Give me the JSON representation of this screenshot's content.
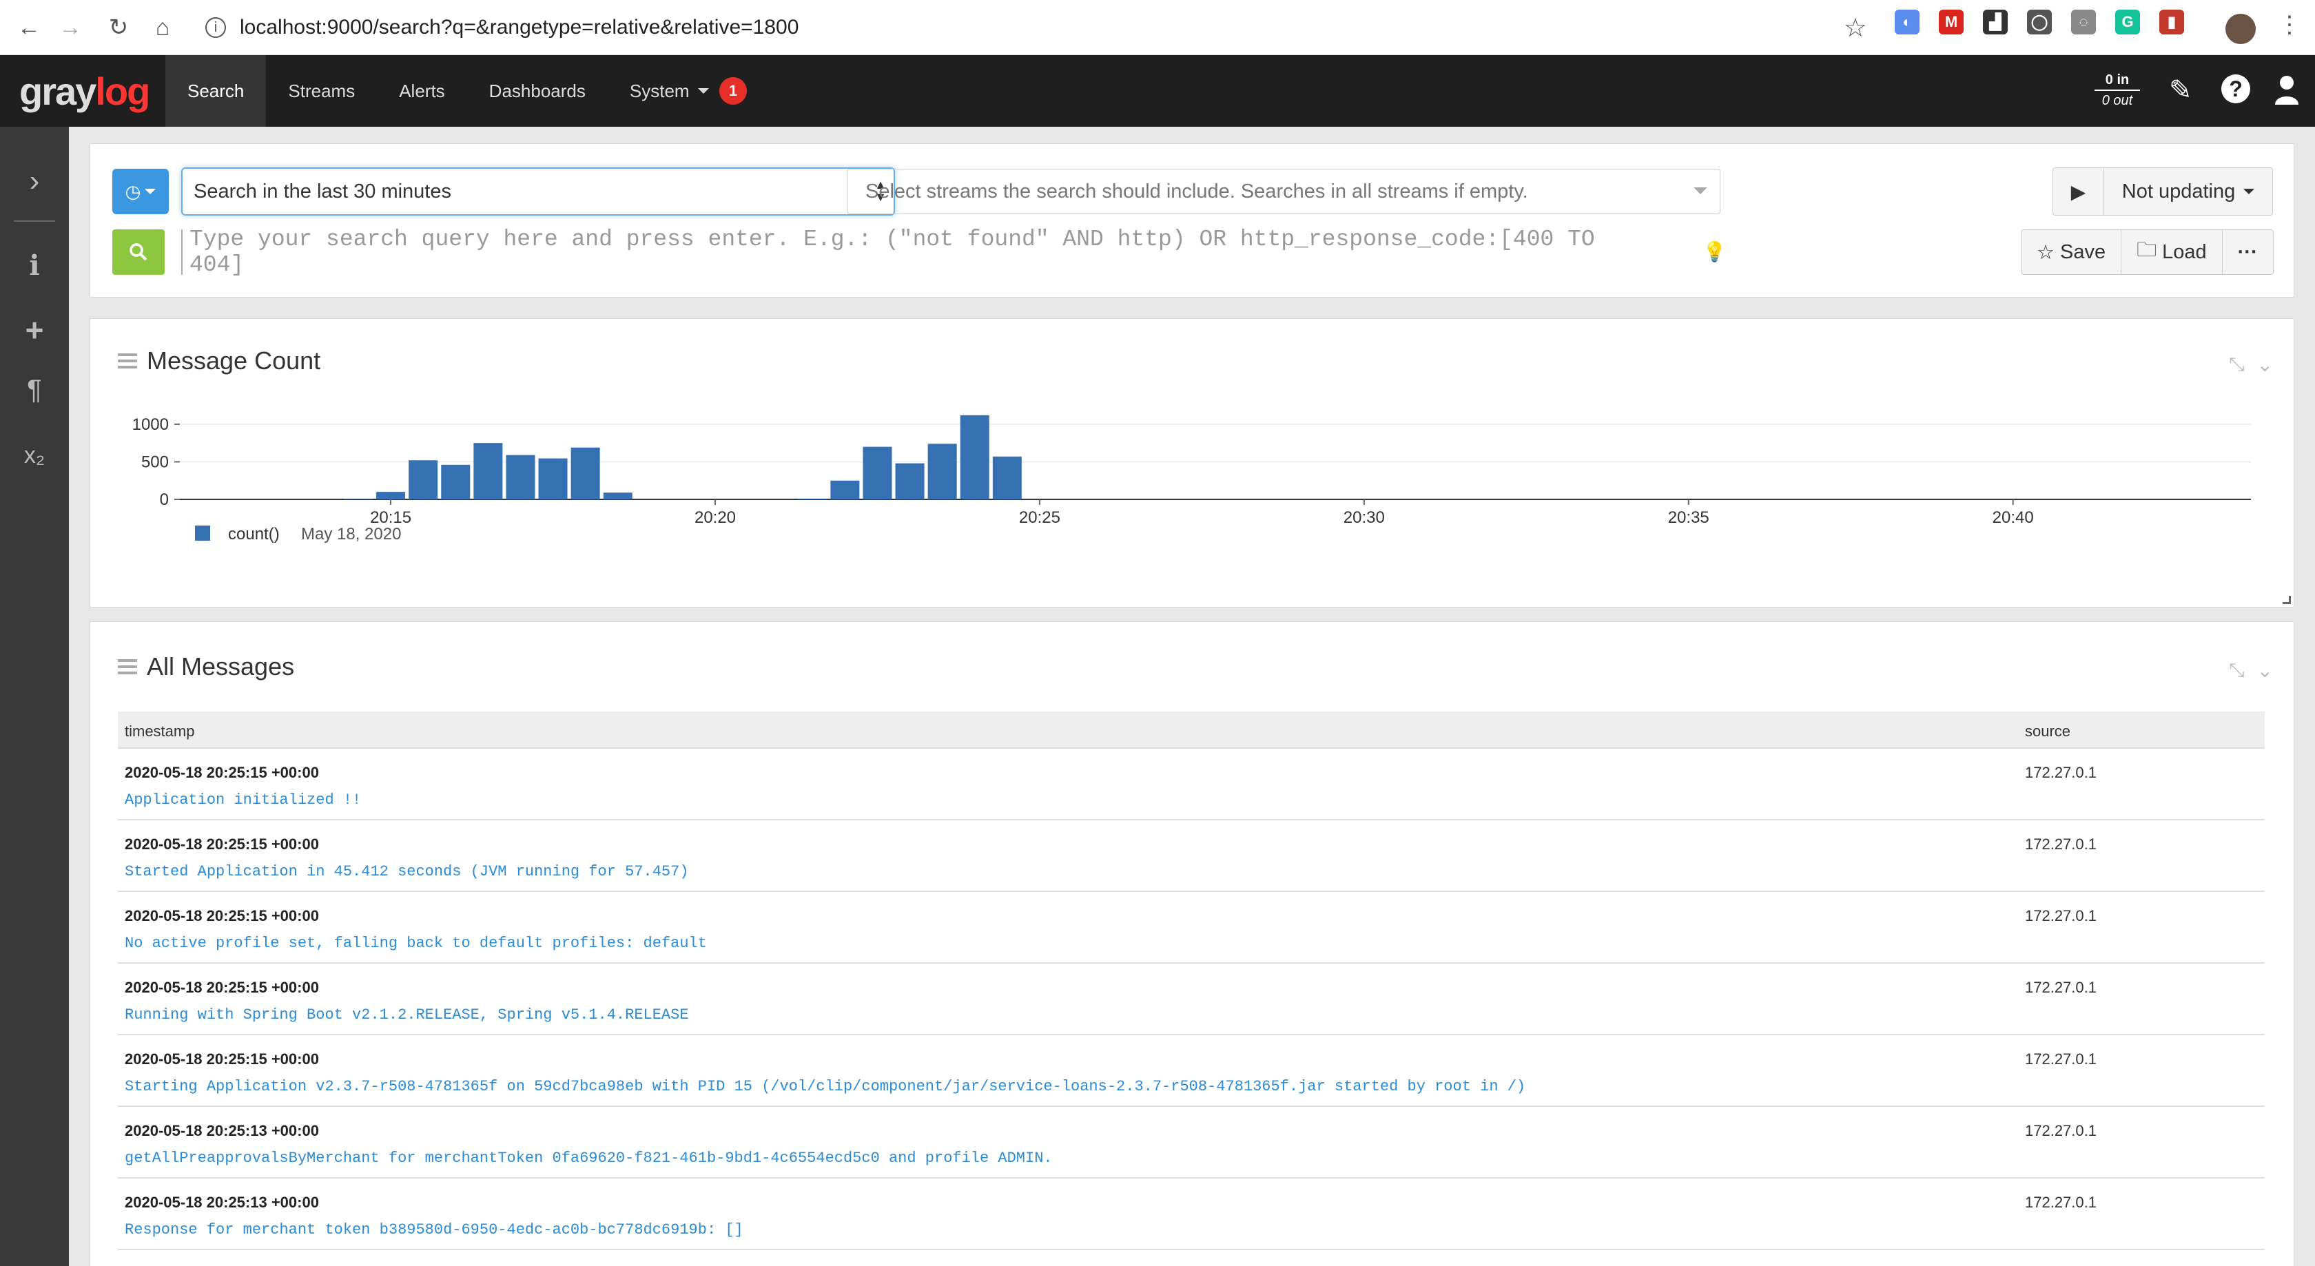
{
  "browser": {
    "url": "localhost:9000/search?q=&rangetype=relative&relative=1800",
    "extensions": [
      {
        "name": "ext-1",
        "color": "#5b8def",
        "glyph": "◐"
      },
      {
        "name": "ext-2",
        "color": "#d9261c",
        "glyph": "M"
      },
      {
        "name": "ext-3",
        "color": "#333333",
        "glyph": "▟"
      },
      {
        "name": "ext-4",
        "color": "#555555",
        "glyph": "◯"
      },
      {
        "name": "ext-5",
        "color": "#888888",
        "glyph": "◌"
      },
      {
        "name": "ext-6",
        "color": "#15c39a",
        "glyph": "G"
      },
      {
        "name": "ext-7",
        "color": "#c0392b",
        "glyph": "▮"
      }
    ]
  },
  "app": {
    "logo_gray": "gray",
    "logo_log": "log",
    "nav": {
      "search": "Search",
      "streams": "Streams",
      "alerts": "Alerts",
      "dashboards": "Dashboards",
      "system": "System"
    },
    "notification_count": "1",
    "throughput_in": "0 in",
    "throughput_out": "0 out"
  },
  "search": {
    "time_range": "Search in the last 30 minutes",
    "streams_placeholder": "Select streams the search should include. Searches in all streams if empty.",
    "update_label": "Not updating",
    "query_placeholder": "Type your search query here and press enter. E.g.: (\"not found\" AND http) OR http_response_code:[400 TO 404]",
    "save_label": "Save",
    "load_label": "Load",
    "more_label": "···"
  },
  "message_count": {
    "title": "Message Count",
    "legend_label": "count()",
    "legend_date": "May 18, 2020"
  },
  "chart_data": {
    "type": "bar",
    "title": "Message Count",
    "xlabel": "",
    "ylabel": "",
    "ylim": [
      0,
      1100
    ],
    "yticks": [
      0,
      500,
      1000
    ],
    "xticks": [
      "20:15",
      "20:20",
      "20:25",
      "20:30",
      "20:35",
      "20:40"
    ],
    "grid": true,
    "legend_placement": "bottom-left",
    "series": [
      {
        "name": "count()",
        "color": "#3570b2",
        "x": [
          "20:14:30",
          "20:15:00",
          "20:15:30",
          "20:16:00",
          "20:16:30",
          "20:17:00",
          "20:17:30",
          "20:18:00",
          "20:18:30",
          "20:21:00",
          "20:21:30",
          "20:22:00",
          "20:22:30",
          "20:23:00",
          "20:23:30",
          "20:24:00",
          "20:24:30",
          "20:25:00"
        ],
        "values": [
          5,
          100,
          520,
          460,
          750,
          590,
          545,
          690,
          90,
          0,
          10,
          250,
          700,
          480,
          740,
          1120,
          570,
          0
        ]
      }
    ]
  },
  "messages": {
    "title": "All Messages",
    "col_timestamp": "timestamp",
    "col_source": "source",
    "rows": [
      {
        "timestamp": "2020-05-18 20:25:15 +00:00",
        "message": "Application initialized !!",
        "source": "172.27.0.1"
      },
      {
        "timestamp": "2020-05-18 20:25:15 +00:00",
        "message": "Started Application in 45.412 seconds (JVM running for 57.457)",
        "source": "172.27.0.1"
      },
      {
        "timestamp": "2020-05-18 20:25:15 +00:00",
        "message": "No active profile set, falling back to default profiles: default",
        "source": "172.27.0.1"
      },
      {
        "timestamp": "2020-05-18 20:25:15 +00:00",
        "message": "Running with Spring Boot v2.1.2.RELEASE, Spring v5.1.4.RELEASE",
        "source": "172.27.0.1"
      },
      {
        "timestamp": "2020-05-18 20:25:15 +00:00",
        "message": "Starting Application v2.3.7-r508-4781365f on 59cd7bca98eb with PID 15 (/vol/clip/component/jar/service-loans-2.3.7-r508-4781365f.jar started by root in /)",
        "source": "172.27.0.1"
      },
      {
        "timestamp": "2020-05-18 20:25:13 +00:00",
        "message": "getAllPreapprovalsByMerchant for merchantToken 0fa69620-f821-461b-9bd1-4c6554ecd5c0 and profile ADMIN.",
        "source": "172.27.0.1"
      },
      {
        "timestamp": "2020-05-18 20:25:13 +00:00",
        "message": "Response for merchant token b389580d-6950-4edc-ac0b-bc778dc6919b: []",
        "source": "172.27.0.1"
      }
    ]
  }
}
